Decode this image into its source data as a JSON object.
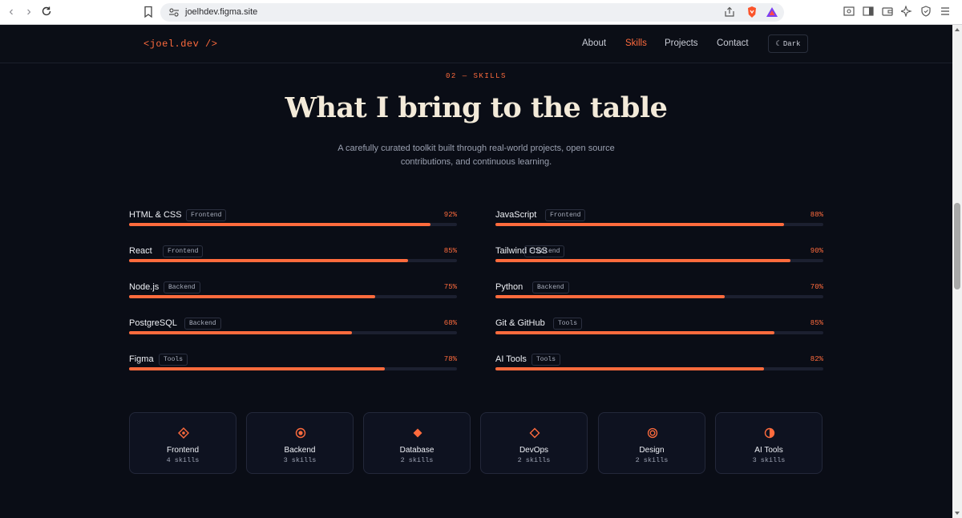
{
  "browser": {
    "url": "joelhdev.figma.site"
  },
  "header": {
    "logo": "<joel.dev />",
    "nav": [
      "About",
      "Skills",
      "Projects",
      "Contact"
    ],
    "active_nav": "Skills",
    "theme_label": "Dark"
  },
  "hero": {
    "eyebrow": "02 — SKILLS",
    "title": "What I bring to the table",
    "subtitle": "A carefully curated toolkit built through real-world projects, open source contributions, and continuous learning."
  },
  "skills": [
    {
      "name": "HTML & CSS",
      "tag": "Frontend",
      "percent": "92%",
      "level": 0.92
    },
    {
      "name": "JavaScript",
      "tag": "Frontend",
      "percent": "88%",
      "level": 0.88
    },
    {
      "name": "React",
      "tag": "Frontend",
      "percent": "85%",
      "level": 0.85
    },
    {
      "name": "Tailwind CSS",
      "tag": "Frontend",
      "percent": "90%",
      "level": 0.9
    },
    {
      "name": "Node.js",
      "tag": "Backend",
      "percent": "75%",
      "level": 0.75
    },
    {
      "name": "Python",
      "tag": "Backend",
      "percent": "70%",
      "level": 0.7
    },
    {
      "name": "PostgreSQL",
      "tag": "Backend",
      "percent": "68%",
      "level": 0.68
    },
    {
      "name": "Git & GitHub",
      "tag": "Tools",
      "percent": "85%",
      "level": 0.85
    },
    {
      "name": "Figma",
      "tag": "Tools",
      "percent": "78%",
      "level": 0.78
    },
    {
      "name": "AI Tools",
      "tag": "Tools",
      "percent": "82%",
      "level": 0.82
    }
  ],
  "categories": [
    {
      "name": "Frontend",
      "count": "4 skills",
      "icon": "diamond-dot-icon"
    },
    {
      "name": "Backend",
      "count": "3 skills",
      "icon": "target-icon"
    },
    {
      "name": "Database",
      "count": "2 skills",
      "icon": "diamond-icon"
    },
    {
      "name": "DevOps",
      "count": "2 skills",
      "icon": "diamond-outline-icon"
    },
    {
      "name": "Design",
      "count": "2 skills",
      "icon": "bullseye-icon"
    },
    {
      "name": "AI Tools",
      "count": "3 skills",
      "icon": "half-circle-icon"
    }
  ],
  "colors": {
    "accent": "#ff6b3d",
    "background": "#0a0d16"
  }
}
